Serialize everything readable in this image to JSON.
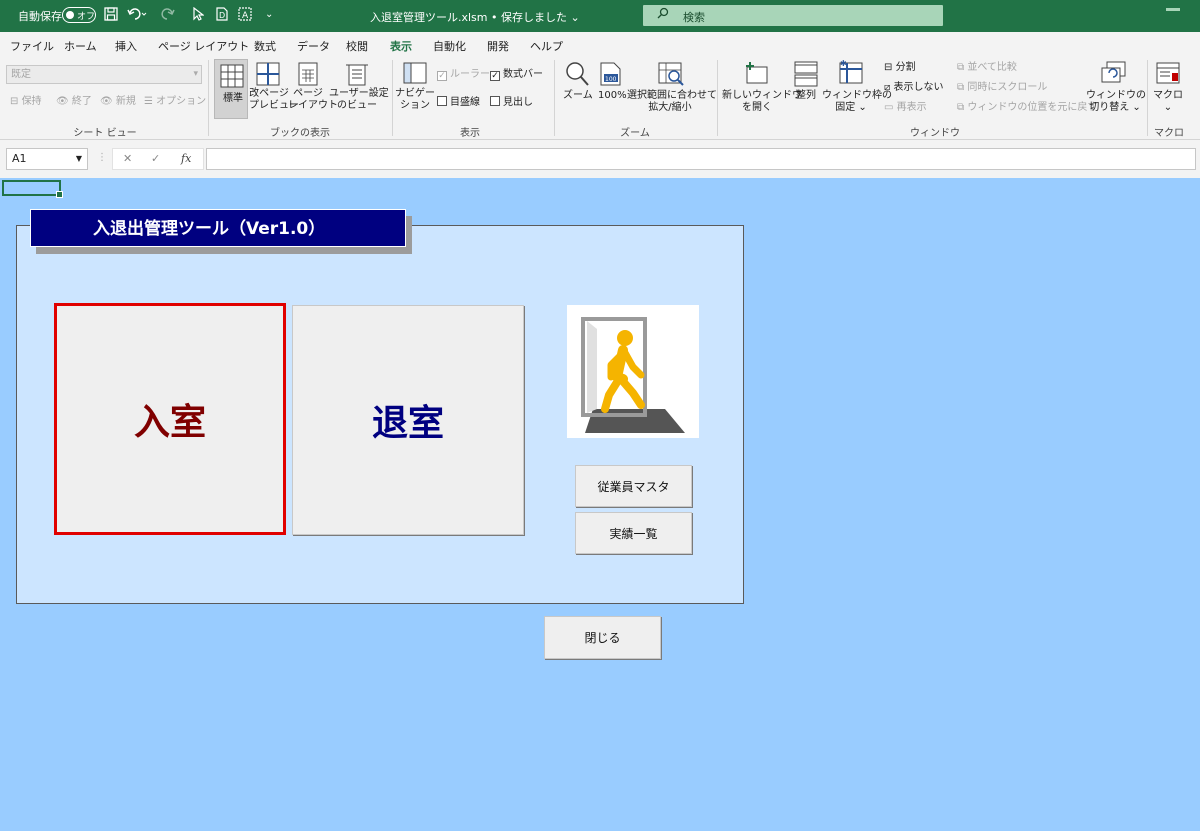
{
  "titlebar": {
    "autosave_label": "自動保存",
    "toggle_label": "オフ",
    "document_title": "入退室管理ツール.xlsm • 保存しました ⌄",
    "search_placeholder": "検索"
  },
  "ribbon_tabs": [
    {
      "label": "ファイル"
    },
    {
      "label": "ホーム"
    },
    {
      "label": "挿入"
    },
    {
      "label": "ページ レイアウト"
    },
    {
      "label": "数式"
    },
    {
      "label": "データ"
    },
    {
      "label": "校閲"
    },
    {
      "label": "表示",
      "active": true
    },
    {
      "label": "自動化"
    },
    {
      "label": "開発"
    },
    {
      "label": "ヘルプ"
    }
  ],
  "ribbon": {
    "sheet_view": {
      "select_value": "既定",
      "keep": "保持",
      "exit": "終了",
      "new": "新規",
      "options": "オプション",
      "group_label": "シート ビュー"
    },
    "workbook_views": {
      "normal": "標準",
      "page_break_line1": "改ページ",
      "page_break_line2": "プレビュー",
      "page_layout_line1": "ページ",
      "page_layout_line2": "レイアウト",
      "custom_line1": "ユーザー設定",
      "custom_line2": "のビュー",
      "group_label": "ブックの表示"
    },
    "show": {
      "navigation_line1": "ナビゲー",
      "navigation_line2": "ション",
      "ruler": "ルーラー",
      "formula_bar": "数式バー",
      "gridlines": "目盛線",
      "headings": "見出し",
      "group_label": "表示"
    },
    "zoom": {
      "zoom": "ズーム",
      "hundred": "100%",
      "selection_line1": "選択範囲に合わせて",
      "selection_line2": "拡大/縮小",
      "group_label": "ズーム"
    },
    "window": {
      "new_window_line1": "新しいウィンドウ",
      "new_window_line2": "を開く",
      "arrange": "整列",
      "freeze_line1": "ウィンドウ枠の",
      "freeze_line2": "固定 ⌄",
      "split": "分割",
      "hide": "表示しない",
      "unhide": "再表示",
      "side_by_side": "並べて比較",
      "sync_scroll": "同時にスクロール",
      "reset_position": "ウィンドウの位置を元に戻す",
      "switch_line1": "ウィンドウの",
      "switch_line2": "切り替え ⌄",
      "group_label": "ウィンドウ"
    },
    "macros": {
      "macros": "マクロ",
      "group_label": "マクロ"
    }
  },
  "formula_bar": {
    "name_box": "A1",
    "cancel": "✕",
    "enter": "✓",
    "fx": "fx",
    "value": ""
  },
  "tool": {
    "title": "入退出管理ツール（Ver1.0）",
    "enter_button": "入室",
    "exit_button": "退室",
    "employee_master_button": "従業員マスタ",
    "records_button": "実績一覧",
    "close_button": "閉じる"
  },
  "colors": {
    "excel_green": "#217346",
    "sheet_background": "#99ccff",
    "panel_background": "#cce5ff",
    "title_background": "#000080",
    "enter_text": "#800000",
    "exit_text": "#000080",
    "selection_border": "#e00000"
  }
}
